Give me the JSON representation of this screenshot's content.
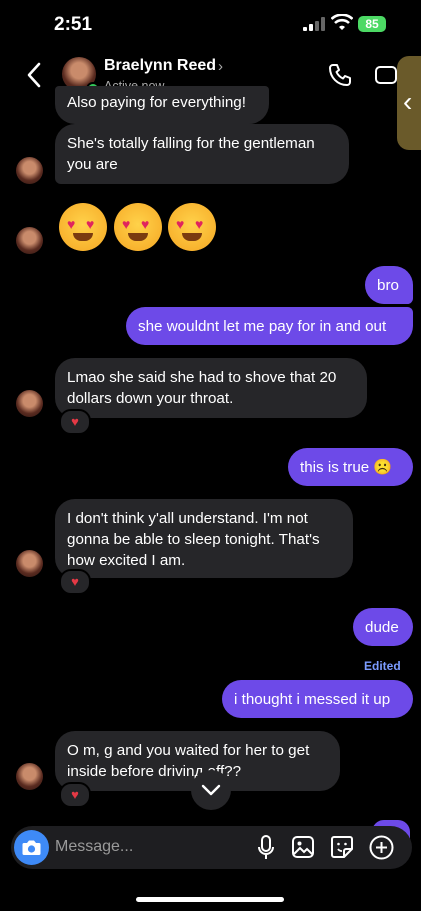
{
  "status": {
    "time": "2:51",
    "battery": "85"
  },
  "header": {
    "name": "Braelynn Reed",
    "status": "Active now"
  },
  "messages": {
    "m0": "Also paying for everything!",
    "m1": "She's totally falling for the gentleman you are",
    "m2": "bro",
    "m3": "she wouldnt let me pay for in and out",
    "m4": "Lmao she said she had to shove that 20 dollars down your throat.",
    "m5": "this is true ☹️",
    "m6": "I don't think y'all understand. I'm not gonna be able to sleep tonight. That's how excited I am.",
    "m7": "dude",
    "m8": "i thought i messed it up",
    "m9": "O m, g and you waited for her to get inside before drivinд off??"
  },
  "edited_label": "Edited",
  "composer": {
    "placeholder": "Message..."
  },
  "colors": {
    "outgoing": "#6d4ae8",
    "incoming": "#262629",
    "accent": "#3e8af7"
  }
}
